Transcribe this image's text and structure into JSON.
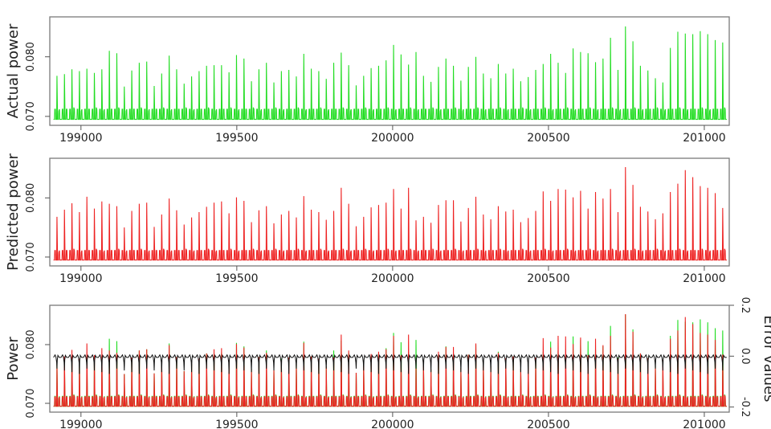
{
  "chart_data": [
    {
      "type": "line",
      "title": "",
      "xlabel": "",
      "ylabel": "Actual power",
      "xlim": [
        198900,
        201080
      ],
      "ylim": [
        0.0685,
        0.0867
      ],
      "x_ticks": [
        199000,
        199500,
        200000,
        200500,
        201000
      ],
      "x_tick_labels": [
        "199000",
        "199500",
        "200000",
        "200500",
        "201000"
      ],
      "y_ticks": [
        0.07,
        0.08
      ],
      "y_tick_labels": [
        "0.070",
        "0.080"
      ],
      "grid": false,
      "series": [
        {
          "color": "#22dd22",
          "baseline": 0.0695,
          "secondary_peak": 0.0712,
          "peak_x": [
            198924,
            198948,
            198972,
            198996,
            199020,
            199044,
            199068,
            199092,
            199116,
            199140,
            199164,
            199188,
            199212,
            199236,
            199260,
            199284,
            199308,
            199332,
            199356,
            199380,
            199404,
            199428,
            199452,
            199476,
            199500,
            199524,
            199548,
            199572,
            199596,
            199620,
            199644,
            199668,
            199692,
            199716,
            199740,
            199764,
            199788,
            199812,
            199836,
            199860,
            199884,
            199908,
            199932,
            199956,
            199980,
            200004,
            200028,
            200052,
            200076,
            200100,
            200124,
            200148,
            200172,
            200196,
            200220,
            200244,
            200268,
            200292,
            200316,
            200340,
            200364,
            200388,
            200412,
            200436,
            200460,
            200484,
            200508,
            200532,
            200556,
            200580,
            200604,
            200628,
            200652,
            200676,
            200700,
            200724,
            200748,
            200772,
            200796,
            200820,
            200844,
            200868,
            200892,
            200916,
            200940,
            200964,
            200988,
            201012,
            201036,
            201060
          ],
          "peak_y": [
            0.0768,
            0.0771,
            0.0779,
            0.0776,
            0.078,
            0.0773,
            0.0779,
            0.081,
            0.0806,
            0.075,
            0.0777,
            0.079,
            0.0792,
            0.0751,
            0.0772,
            0.0802,
            0.0779,
            0.0755,
            0.0767,
            0.0776,
            0.0785,
            0.0786,
            0.0786,
            0.0774,
            0.0803,
            0.0797,
            0.0759,
            0.0779,
            0.079,
            0.0757,
            0.0776,
            0.0778,
            0.0767,
            0.0805,
            0.078,
            0.0776,
            0.0763,
            0.079,
            0.0807,
            0.0786,
            0.0752,
            0.0768,
            0.0781,
            0.0785,
            0.0794,
            0.082,
            0.0804,
            0.0787,
            0.0808,
            0.0768,
            0.0758,
            0.0783,
            0.0797,
            0.0785,
            0.076,
            0.0783,
            0.08,
            0.0772,
            0.0764,
            0.0788,
            0.0772,
            0.078,
            0.0759,
            0.0766,
            0.0778,
            0.0788,
            0.0805,
            0.079,
            0.0773,
            0.0814,
            0.0808,
            0.0806,
            0.0791,
            0.0797,
            0.0832,
            0.0778,
            0.0851,
            0.0826,
            0.0785,
            0.0777,
            0.0764,
            0.0757,
            0.0815,
            0.0842,
            0.0839,
            0.0838,
            0.0843,
            0.0838,
            0.0828,
            0.0824
          ]
        }
      ]
    },
    {
      "type": "line",
      "title": "",
      "xlabel": "",
      "ylabel": "Predicted power",
      "xlim": [
        198900,
        201080
      ],
      "ylim": [
        0.0685,
        0.0867
      ],
      "x_ticks": [
        199000,
        199500,
        200000,
        200500,
        201000
      ],
      "x_tick_labels": [
        "199000",
        "199500",
        "200000",
        "200500",
        "201000"
      ],
      "y_ticks": [
        0.07,
        0.08
      ],
      "y_tick_labels": [
        "0.070",
        "0.080"
      ],
      "grid": false,
      "series": [
        {
          "color": "#ee2222",
          "baseline": 0.0695,
          "secondary_peak": 0.0711,
          "peak_x": [
            198924,
            198948,
            198972,
            198996,
            199020,
            199044,
            199068,
            199092,
            199116,
            199140,
            199164,
            199188,
            199212,
            199236,
            199260,
            199284,
            199308,
            199332,
            199356,
            199380,
            199404,
            199428,
            199452,
            199476,
            199500,
            199524,
            199548,
            199572,
            199596,
            199620,
            199644,
            199668,
            199692,
            199716,
            199740,
            199764,
            199788,
            199812,
            199836,
            199860,
            199884,
            199908,
            199932,
            199956,
            199980,
            200004,
            200028,
            200052,
            200076,
            200100,
            200124,
            200148,
            200172,
            200196,
            200220,
            200244,
            200268,
            200292,
            200316,
            200340,
            200364,
            200388,
            200412,
            200436,
            200460,
            200484,
            200508,
            200532,
            200556,
            200580,
            200604,
            200628,
            200652,
            200676,
            200700,
            200724,
            200748,
            200772,
            200796,
            200820,
            200844,
            200868,
            200892,
            200916,
            200940,
            200964,
            200988,
            201012,
            201036,
            201060
          ],
          "peak_y": [
            0.0768,
            0.078,
            0.0791,
            0.0776,
            0.0802,
            0.0782,
            0.0794,
            0.079,
            0.0786,
            0.075,
            0.0778,
            0.079,
            0.0792,
            0.0751,
            0.0772,
            0.0799,
            0.0779,
            0.0755,
            0.0767,
            0.0776,
            0.0785,
            0.0792,
            0.0794,
            0.0774,
            0.0801,
            0.0795,
            0.0759,
            0.0779,
            0.0786,
            0.0757,
            0.0772,
            0.0778,
            0.0767,
            0.0803,
            0.078,
            0.0776,
            0.0763,
            0.0778,
            0.0817,
            0.079,
            0.0752,
            0.0768,
            0.0784,
            0.0788,
            0.0792,
            0.0815,
            0.0782,
            0.0817,
            0.0762,
            0.0768,
            0.0758,
            0.0788,
            0.0796,
            0.0796,
            0.076,
            0.0783,
            0.0802,
            0.0772,
            0.0764,
            0.0786,
            0.0777,
            0.078,
            0.0759,
            0.0766,
            0.0778,
            0.0811,
            0.0795,
            0.0815,
            0.0814,
            0.0801,
            0.0812,
            0.0782,
            0.081,
            0.0799,
            0.0815,
            0.0776,
            0.0852,
            0.0822,
            0.0785,
            0.0777,
            0.0764,
            0.0774,
            0.081,
            0.0824,
            0.0847,
            0.0835,
            0.082,
            0.0817,
            0.0808,
            0.0783
          ]
        }
      ]
    },
    {
      "type": "line",
      "title": "",
      "xlabel": "",
      "ylabel": "Power",
      "ylabel_right": "Error values",
      "xlim": [
        198900,
        201080
      ],
      "ylim": [
        0.0685,
        0.0867
      ],
      "ylim_right": [
        -0.22,
        0.2
      ],
      "x_ticks": [
        199000,
        199500,
        200000,
        200500,
        201000
      ],
      "x_tick_labels": [
        "199000",
        "199500",
        "200000",
        "200500",
        "201000"
      ],
      "y_ticks": [
        0.07,
        0.08
      ],
      "y_tick_labels": [
        "0.070",
        "0.080"
      ],
      "y_right_ticks": [
        -0.2,
        0.0,
        0.2
      ],
      "y_right_tick_labels": [
        "-0.2",
        "0.0",
        "0.2"
      ],
      "grid": false,
      "series": [
        {
          "color": "#22dd22",
          "overlay_of": "Actual power"
        },
        {
          "color": "#ee2222",
          "overlay_of": "Predicted power"
        },
        {
          "color": "#111111",
          "axis": "right",
          "baseline": -0.005,
          "dip": -0.07
        }
      ]
    }
  ]
}
